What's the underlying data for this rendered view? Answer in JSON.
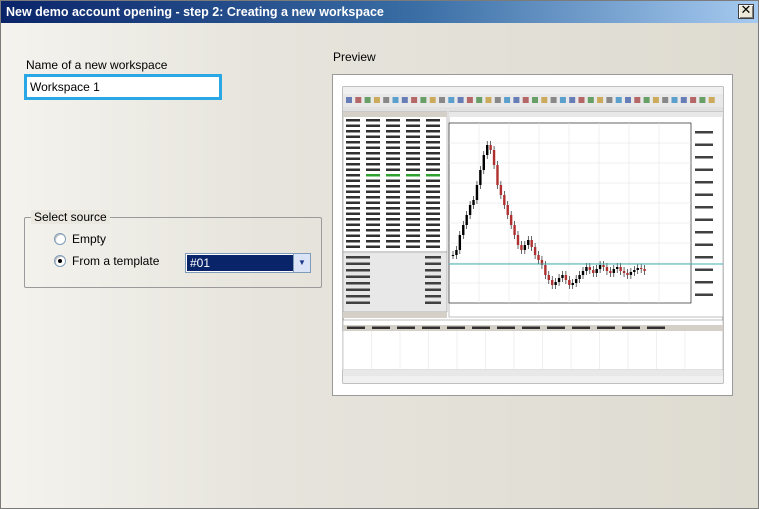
{
  "window": {
    "title": "New demo account opening - step 2: Creating a new workspace",
    "close_glyph": "✕"
  },
  "workspace": {
    "label": "Name of a new workspace",
    "value": "Workspace 1"
  },
  "source": {
    "legend": "Select source",
    "options": [
      {
        "label": "Empty",
        "checked": false
      },
      {
        "label": "From a template",
        "checked": true
      }
    ],
    "template_value": "#01"
  },
  "preview": {
    "label": "Preview"
  },
  "icons": {
    "close": "close-icon",
    "dropdown": "chevron-down-icon"
  },
  "colors": {
    "title_start": "#0a246a",
    "title_end": "#a6caf0",
    "input_focus": "#2aa7e5",
    "selection": "#0a246a",
    "candle_bull": "#000000",
    "candle_bear": "#b03030",
    "level_line": "#40b0b0"
  }
}
